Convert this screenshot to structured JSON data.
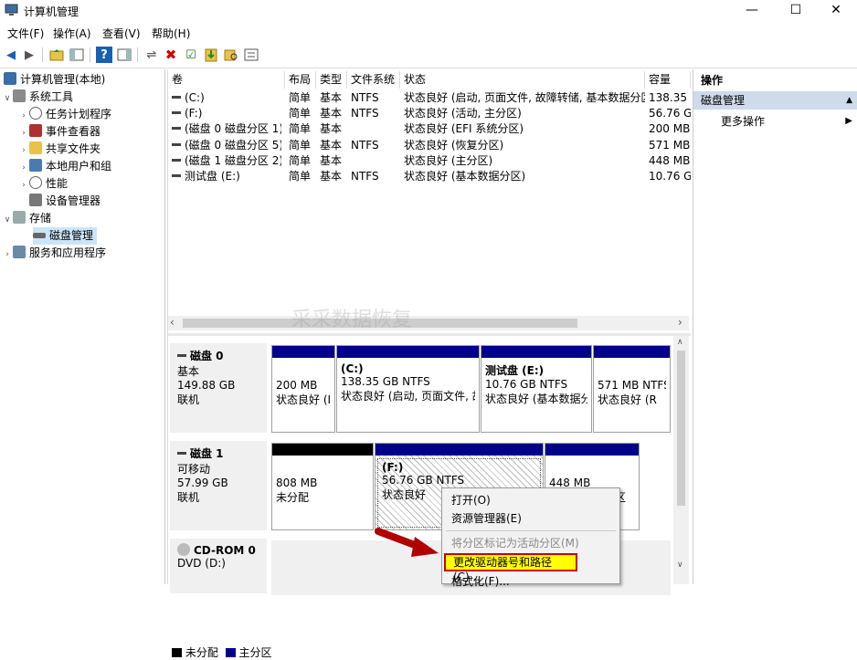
{
  "window": {
    "title": "计算机管理",
    "minimize": "—",
    "maximize": "☐",
    "close": "✕"
  },
  "menu": [
    "文件(F)",
    "操作(A)",
    "查看(V)",
    "帮助(H)"
  ],
  "tree": {
    "root": "计算机管理(本地)",
    "system_tools": "系统工具",
    "task_scheduler": "任务计划程序",
    "event_viewer": "事件查看器",
    "shared_folders": "共享文件夹",
    "local_users": "本地用户和组",
    "performance": "性能",
    "device_manager": "设备管理器",
    "storage": "存储",
    "disk_management": "磁盘管理",
    "services_apps": "服务和应用程序"
  },
  "table": {
    "headers": [
      "卷",
      "布局",
      "类型",
      "文件系统",
      "状态",
      "容量"
    ],
    "rows": [
      [
        "(C:)",
        "简单",
        "基本",
        "NTFS",
        "状态良好 (启动, 页面文件, 故障转储, 基本数据分区)",
        "138.35"
      ],
      [
        "(F:)",
        "简单",
        "基本",
        "NTFS",
        "状态良好 (活动, 主分区)",
        "56.76 G"
      ],
      [
        "(磁盘 0 磁盘分区 1)",
        "简单",
        "基本",
        "",
        "状态良好 (EFI 系统分区)",
        "200 MB"
      ],
      [
        "(磁盘 0 磁盘分区 5)",
        "简单",
        "基本",
        "NTFS",
        "状态良好 (恢复分区)",
        "571 MB"
      ],
      [
        "(磁盘 1 磁盘分区 2)",
        "简单",
        "基本",
        "",
        "状态良好 (主分区)",
        "448 MB"
      ],
      [
        "测试盘 (E:)",
        "简单",
        "基本",
        "NTFS",
        "状态良好 (基本数据分区)",
        "10.76 G"
      ]
    ]
  },
  "watermark": "采采数据恢复",
  "disks": {
    "disk0": {
      "name": "磁盘 0",
      "type": "基本",
      "size": "149.88 GB",
      "status": "联机",
      "parts": [
        {
          "l1": "",
          "l2": "200 MB",
          "l3": "状态良好 (I"
        },
        {
          "l1": "(C:)",
          "l2": "138.35 GB NTFS",
          "l3": "状态良好 (启动, 页面文件, 故"
        },
        {
          "l1": "测试盘 (E:)",
          "l2": "10.76 GB NTFS",
          "l3": "状态良好 (基本数据分"
        },
        {
          "l1": "",
          "l2": "571 MB NTFS",
          "l3": "状态良好 (R"
        }
      ]
    },
    "disk1": {
      "name": "磁盘 1",
      "type": "可移动",
      "size": "57.99 GB",
      "status": "联机",
      "parts": [
        {
          "l1": "",
          "l2": "808 MB",
          "l3": "未分配"
        },
        {
          "l1": "(F:)",
          "l2": "56.76 GB NTFS",
          "l3": "状态良好"
        },
        {
          "l1": "",
          "l2": "448 MB",
          "l3": "区"
        }
      ]
    },
    "cdrom": {
      "name": "CD-ROM 0",
      "type": "DVD (D:)"
    }
  },
  "legend": {
    "unallocated": "未分配",
    "primary": "主分区"
  },
  "context_menu": {
    "open": "打开(O)",
    "explorer": "资源管理器(E)",
    "mark_active": "将分区标记为活动分区(M)",
    "change_letter": "更改驱动器号和路径(C)...",
    "format": "格式化(F)..."
  },
  "actions": {
    "header": "操作",
    "section": "磁盘管理",
    "more": "更多操作"
  },
  "colors": {
    "accent": "#00008b",
    "selection": "#ffff00",
    "unalloc": "#000000",
    "highlight_box": "#cc0000"
  }
}
